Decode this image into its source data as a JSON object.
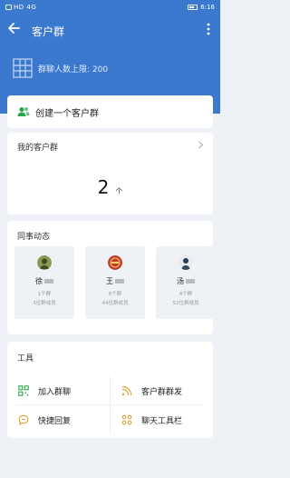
{
  "status_bar": {
    "carrier_icons": "HD 4G",
    "time": "6:16"
  },
  "navbar": {
    "title": "客户群",
    "back_icon": "arrow-left-icon",
    "more_icon": "more-vertical-icon"
  },
  "group_limit": {
    "text": "群聊人数上限: 200",
    "icon": "grid-icon"
  },
  "create_group": {
    "label": "创建一个客户群",
    "icon": "add-users-icon",
    "icon_color": "#2aa64a"
  },
  "my_groups": {
    "title": "我的客户群",
    "count": "2",
    "unit": "个"
  },
  "dynamics": {
    "title": "同事动态",
    "colleagues": [
      {
        "name": "徐",
        "groups": "1个群",
        "members": "3位群成员",
        "avatar_color": "#6b7a3a"
      },
      {
        "name": "王",
        "groups": "8个群",
        "members": "44位群成员",
        "avatar_color": "#c0392b"
      },
      {
        "name": "汤",
        "groups": "4个群",
        "members": "52位群成员",
        "avatar_color": "#34495e"
      }
    ]
  },
  "tools": {
    "title": "工具",
    "items": [
      {
        "label": "加入群聊",
        "icon": "qr-code-icon",
        "color": "#2aa64a"
      },
      {
        "label": "客户群群发",
        "icon": "broadcast-icon",
        "color": "#e0a030"
      },
      {
        "label": "快捷回复",
        "icon": "chat-bubble-icon",
        "color": "#e0a030"
      },
      {
        "label": "聊天工具栏",
        "icon": "toolbar-icon",
        "color": "#e0a030"
      }
    ]
  },
  "colors": {
    "header_bg": "#3b79cf",
    "page_bg": "#eef1f5"
  }
}
